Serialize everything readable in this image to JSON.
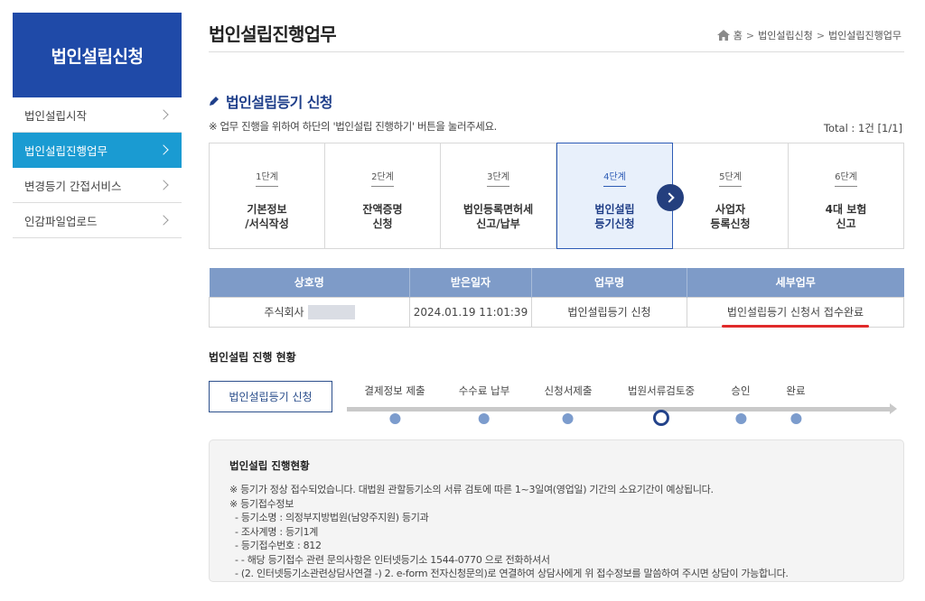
{
  "sidebar": {
    "title": "법인설립신청",
    "items": [
      {
        "label": "법인설립시작"
      },
      {
        "label": "법인설립진행업무"
      },
      {
        "label": "변경등기 간접서비스"
      },
      {
        "label": "인감파일업로드"
      }
    ]
  },
  "header": {
    "title": "법인설립진행업무",
    "breadcrumb": [
      "홈",
      "법인설립신청",
      "법인설립진행업무"
    ]
  },
  "section": {
    "title": "법인설립등기 신청",
    "notice": "※ 업무 진행을 위하여 하단의 '법인설립 진행하기' 버튼을 눌러주세요.",
    "total": "Total : 1건 [1/1]"
  },
  "steps": [
    {
      "num": "1단계",
      "label": "기본정보\n/서식작성"
    },
    {
      "num": "2단계",
      "label": "잔액증명\n신청"
    },
    {
      "num": "3단계",
      "label": "법인등록면허세\n신고/납부"
    },
    {
      "num": "4단계",
      "label": "법인설립\n등기신청"
    },
    {
      "num": "5단계",
      "label": "사업자\n등록신청"
    },
    {
      "num": "6단계",
      "label": "4대 보험\n신고"
    }
  ],
  "table": {
    "headers": [
      "상호명",
      "받은일자",
      "업무명",
      "세부업무"
    ],
    "row": {
      "company": "주식회사",
      "date": "2024.01.19 11:01:39",
      "task": "법인설립등기 신청",
      "detail": "법인설립등기 신청서 접수완료"
    }
  },
  "progress": {
    "title": "법인설립 진행 현황",
    "box_label": "법인설립등기 신청",
    "steps": [
      "결제정보 제출",
      "수수료 납부",
      "신청서제출",
      "법원서류검토중",
      "승인",
      "완료"
    ],
    "current_index": 3
  },
  "detail": {
    "title": "법인설립 진행현황",
    "lines": [
      "※ 등기가 정상 접수되었습니다. 대법원 관할등기소의 서류 검토에 따른 1~3일여(영업일) 기간의 소요기간이 예상됩니다.",
      "※ 등기접수정보"
    ],
    "sub_lines": [
      "- 등기소명 : 의정부지방법원(남양주지원) 등기과",
      "- 조사계명 : 등기1계",
      "- 등기접수번호 : 812",
      "- - 해당 등기접수 관련 문의사항은 인터넷등기소 1544-0770 으로 전화하셔서",
      "- (2. 인터넷등기소관련상담사연결 -) 2. e-form 전자신청문의)로 연결하여 상담사에게 위 접수정보를 말씀하여 주시면 상담이 가능합니다."
    ]
  },
  "colors": {
    "sidebar_title_bg": "#1f4aa8",
    "sidebar_active_bg": "#1a9bd2",
    "table_header_bg": "#7e9bc8",
    "highlight_underline": "#e02a2a",
    "accent_navy": "#243f7e"
  }
}
